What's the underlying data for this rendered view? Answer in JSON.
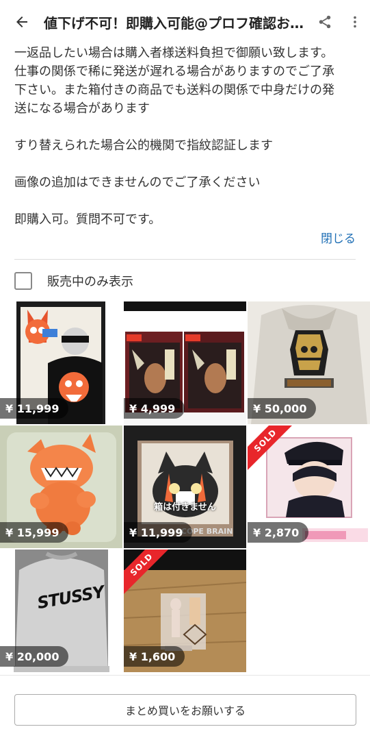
{
  "header": {
    "title": "値下げ不可！即購入可能@プロフ確認お願いします"
  },
  "description": {
    "lines": [
      "一返品したい場合は購入者様送料負担で御願い致します。",
      "仕事の関係で稀に発送が遅れる場合がありますのでご了承",
      "下さい。また箱付きの商品でも送料の関係で中身だけの発",
      "送になる場合があります",
      "すり替えられた場合公的機関で指紋認証します",
      "画像の追加はできませんのでご了承ください",
      "即購入可。質問不可です。"
    ],
    "close_label": "閉じる"
  },
  "filter": {
    "label": "販売中のみ表示",
    "checked": false
  },
  "items": [
    {
      "price": "¥ 11,999",
      "sold": false,
      "palette": "#2b2b2b"
    },
    {
      "price": "¥ 4,999",
      "sold": false,
      "palette": "#3a2a2a"
    },
    {
      "price": "¥ 50,000",
      "sold": false,
      "palette": "#d8d4cc"
    },
    {
      "price": "¥ 15,999",
      "sold": false,
      "palette": "#c7cfb1"
    },
    {
      "price": "¥ 11,999",
      "sold": false,
      "palette": "#2a2a2a",
      "caption": "箱は付きません",
      "brand": "SCOPE BRAIN"
    },
    {
      "price": "¥ 2,870",
      "sold": true,
      "sold_label": "SOLD",
      "palette": "#f4eef0"
    },
    {
      "price": "¥ 20,000",
      "sold": false,
      "palette": "#cfcfcf",
      "brand": "STUSSY"
    },
    {
      "price": "¥ 1,600",
      "sold": true,
      "sold_label": "SOLD",
      "palette": "#b08a52"
    }
  ],
  "footer": {
    "bulk_button_label": "まとめ買いをお願いする"
  }
}
